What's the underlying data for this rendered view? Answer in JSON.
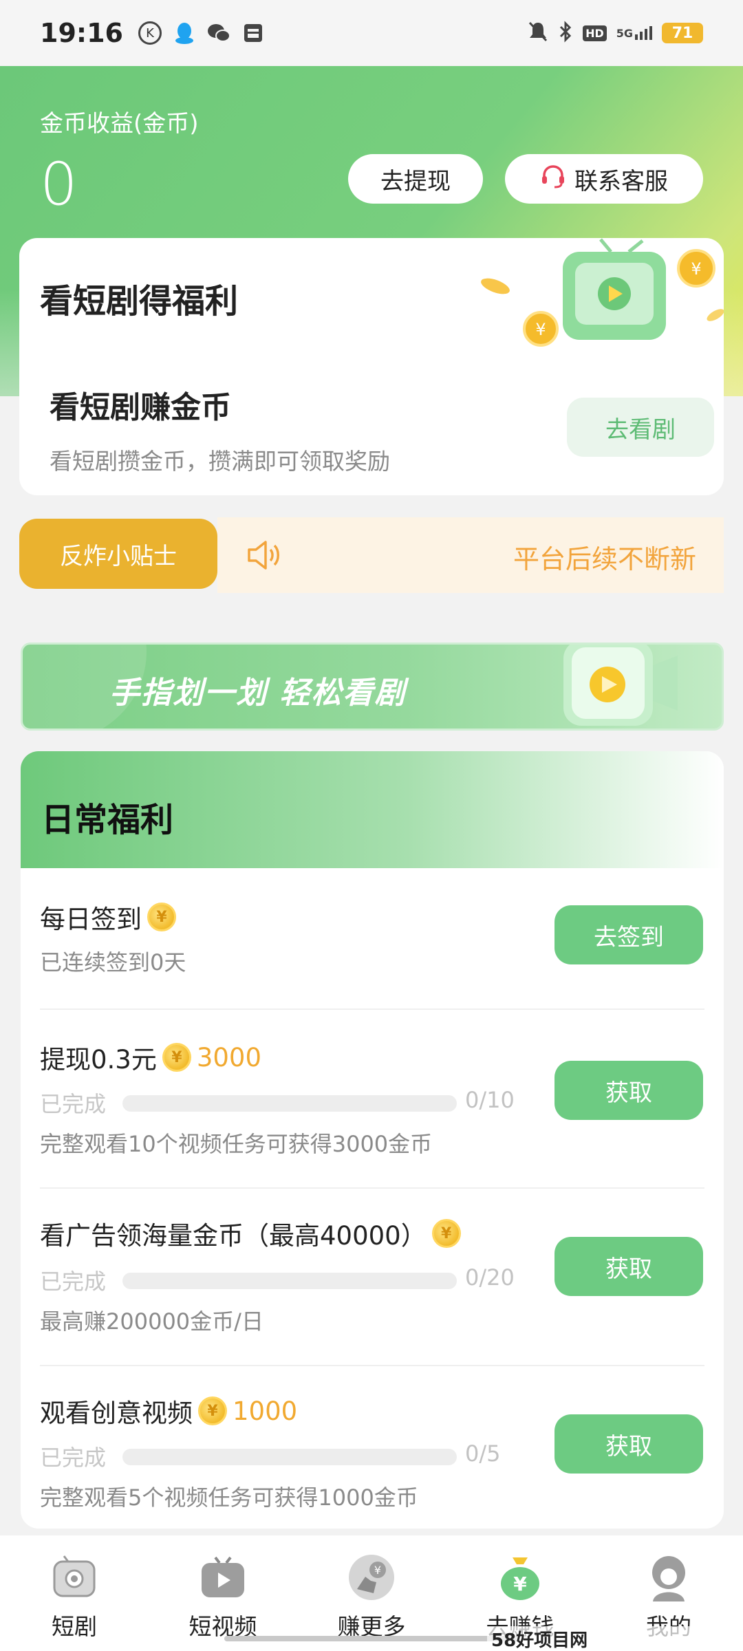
{
  "status_bar": {
    "time": "19:16",
    "battery": "71",
    "network": "5G",
    "hd": "HD"
  },
  "header": {
    "coin_label": "金币收益(金币)",
    "coin_value": "0",
    "withdraw_label": "去提现",
    "service_label": "联系客服"
  },
  "drama_card": {
    "title": "看短剧得福利",
    "sub_title": "看短剧赚金币",
    "desc": "看短剧攒金币，攒满即可领取奖励",
    "button": "去看剧"
  },
  "tip": {
    "tag": "反炸小贴士",
    "marquee": "平台后续不断新"
  },
  "banner": {
    "text": "手指划一划 轻松看剧"
  },
  "daily": {
    "title": "日常福利",
    "tasks": [
      {
        "name": "每日签到",
        "meta": "已连续签到0天",
        "button": "去签到"
      },
      {
        "name": "提现0.3元",
        "reward": "3000",
        "status": "已完成",
        "count": "0/10",
        "progress": 0,
        "meta": "完整观看10个视频任务可获得3000金币",
        "button": "获取"
      },
      {
        "name": "看广告领海量金币（最高40000）",
        "status": "已完成",
        "count": "0/20",
        "progress": 0,
        "meta": "最高赚200000金币/日",
        "button": "获取"
      },
      {
        "name": "观看创意视频",
        "reward": "1000",
        "status": "已完成",
        "count": "0/5",
        "progress": 0,
        "meta": "完整观看5个视频任务可获得1000金币",
        "button": "获取"
      }
    ]
  },
  "nav": {
    "items": [
      {
        "label": "短剧",
        "icon": "tv-icon"
      },
      {
        "label": "短视频",
        "icon": "play-icon"
      },
      {
        "label": "赚更多",
        "icon": "hand-coin-icon"
      },
      {
        "label": "去赚钱",
        "icon": "money-bag-icon"
      },
      {
        "label": "我的",
        "icon": "user-icon"
      }
    ]
  },
  "watermark": "58好项目网www.58hxm.com",
  "colors": {
    "brand_green": "#6dcb82",
    "coin_gold": "#f1a930",
    "tip_orange": "#eab22f"
  }
}
